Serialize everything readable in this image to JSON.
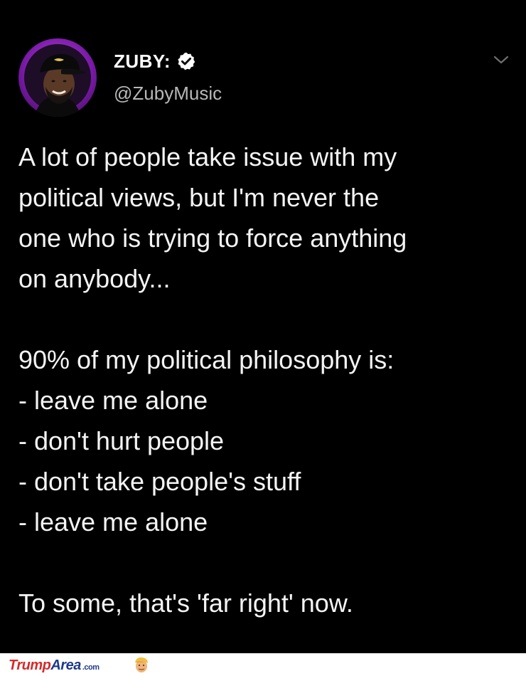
{
  "tweet": {
    "display_name": "ZUBY:",
    "handle": "@ZubyMusic",
    "verified": true,
    "body_lines": [
      "A lot of people take issue with my",
      "political views, but I'm never the",
      "one who is trying to force anything",
      "on anybody...",
      "",
      "90% of my political philosophy is:",
      "- leave me alone",
      "- don't hurt people",
      "- don't take people's stuff",
      "- leave me alone",
      "",
      "To some, that's 'far right' now."
    ],
    "icons": {
      "verified": "verified-badge-icon",
      "menu": "chevron-down-icon"
    }
  },
  "watermark": {
    "brand_part1": "Trump",
    "brand_part2": "Area",
    "brand_suffix": ".com",
    "logo_icon": "trump-face-logo"
  },
  "colors": {
    "background": "#000000",
    "text": "#f4f4f4",
    "handle": "#b8b8b8",
    "avatar_ring": "#c04be0",
    "brand_red": "#d42a2a",
    "brand_blue": "#1f3a8a"
  }
}
